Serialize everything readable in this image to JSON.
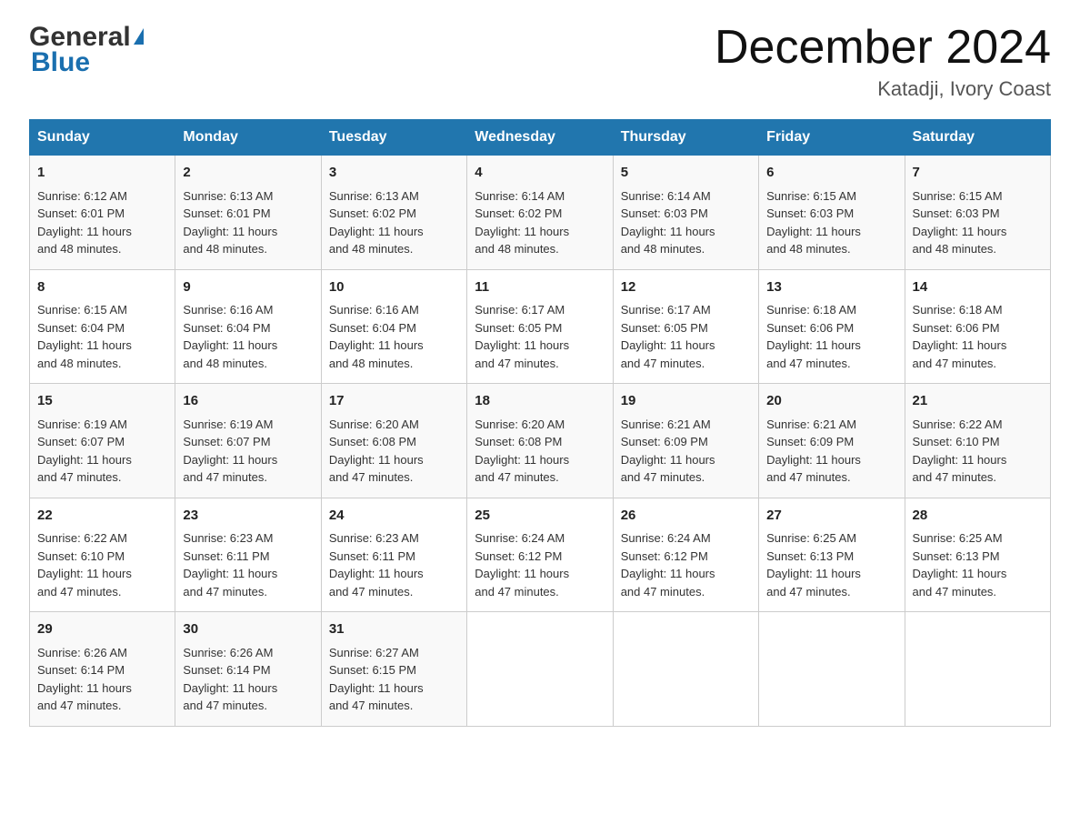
{
  "logo": {
    "name_part1": "General",
    "name_part2": "Blue"
  },
  "header": {
    "title": "December 2024",
    "location": "Katadji, Ivory Coast"
  },
  "columns": [
    "Sunday",
    "Monday",
    "Tuesday",
    "Wednesday",
    "Thursday",
    "Friday",
    "Saturday"
  ],
  "weeks": [
    [
      {
        "day": "1",
        "sunrise": "6:12 AM",
        "sunset": "6:01 PM",
        "daylight": "11 hours and 48 minutes."
      },
      {
        "day": "2",
        "sunrise": "6:13 AM",
        "sunset": "6:01 PM",
        "daylight": "11 hours and 48 minutes."
      },
      {
        "day": "3",
        "sunrise": "6:13 AM",
        "sunset": "6:02 PM",
        "daylight": "11 hours and 48 minutes."
      },
      {
        "day": "4",
        "sunrise": "6:14 AM",
        "sunset": "6:02 PM",
        "daylight": "11 hours and 48 minutes."
      },
      {
        "day": "5",
        "sunrise": "6:14 AM",
        "sunset": "6:03 PM",
        "daylight": "11 hours and 48 minutes."
      },
      {
        "day": "6",
        "sunrise": "6:15 AM",
        "sunset": "6:03 PM",
        "daylight": "11 hours and 48 minutes."
      },
      {
        "day": "7",
        "sunrise": "6:15 AM",
        "sunset": "6:03 PM",
        "daylight": "11 hours and 48 minutes."
      }
    ],
    [
      {
        "day": "8",
        "sunrise": "6:15 AM",
        "sunset": "6:04 PM",
        "daylight": "11 hours and 48 minutes."
      },
      {
        "day": "9",
        "sunrise": "6:16 AM",
        "sunset": "6:04 PM",
        "daylight": "11 hours and 48 minutes."
      },
      {
        "day": "10",
        "sunrise": "6:16 AM",
        "sunset": "6:04 PM",
        "daylight": "11 hours and 48 minutes."
      },
      {
        "day": "11",
        "sunrise": "6:17 AM",
        "sunset": "6:05 PM",
        "daylight": "11 hours and 47 minutes."
      },
      {
        "day": "12",
        "sunrise": "6:17 AM",
        "sunset": "6:05 PM",
        "daylight": "11 hours and 47 minutes."
      },
      {
        "day": "13",
        "sunrise": "6:18 AM",
        "sunset": "6:06 PM",
        "daylight": "11 hours and 47 minutes."
      },
      {
        "day": "14",
        "sunrise": "6:18 AM",
        "sunset": "6:06 PM",
        "daylight": "11 hours and 47 minutes."
      }
    ],
    [
      {
        "day": "15",
        "sunrise": "6:19 AM",
        "sunset": "6:07 PM",
        "daylight": "11 hours and 47 minutes."
      },
      {
        "day": "16",
        "sunrise": "6:19 AM",
        "sunset": "6:07 PM",
        "daylight": "11 hours and 47 minutes."
      },
      {
        "day": "17",
        "sunrise": "6:20 AM",
        "sunset": "6:08 PM",
        "daylight": "11 hours and 47 minutes."
      },
      {
        "day": "18",
        "sunrise": "6:20 AM",
        "sunset": "6:08 PM",
        "daylight": "11 hours and 47 minutes."
      },
      {
        "day": "19",
        "sunrise": "6:21 AM",
        "sunset": "6:09 PM",
        "daylight": "11 hours and 47 minutes."
      },
      {
        "day": "20",
        "sunrise": "6:21 AM",
        "sunset": "6:09 PM",
        "daylight": "11 hours and 47 minutes."
      },
      {
        "day": "21",
        "sunrise": "6:22 AM",
        "sunset": "6:10 PM",
        "daylight": "11 hours and 47 minutes."
      }
    ],
    [
      {
        "day": "22",
        "sunrise": "6:22 AM",
        "sunset": "6:10 PM",
        "daylight": "11 hours and 47 minutes."
      },
      {
        "day": "23",
        "sunrise": "6:23 AM",
        "sunset": "6:11 PM",
        "daylight": "11 hours and 47 minutes."
      },
      {
        "day": "24",
        "sunrise": "6:23 AM",
        "sunset": "6:11 PM",
        "daylight": "11 hours and 47 minutes."
      },
      {
        "day": "25",
        "sunrise": "6:24 AM",
        "sunset": "6:12 PM",
        "daylight": "11 hours and 47 minutes."
      },
      {
        "day": "26",
        "sunrise": "6:24 AM",
        "sunset": "6:12 PM",
        "daylight": "11 hours and 47 minutes."
      },
      {
        "day": "27",
        "sunrise": "6:25 AM",
        "sunset": "6:13 PM",
        "daylight": "11 hours and 47 minutes."
      },
      {
        "day": "28",
        "sunrise": "6:25 AM",
        "sunset": "6:13 PM",
        "daylight": "11 hours and 47 minutes."
      }
    ],
    [
      {
        "day": "29",
        "sunrise": "6:26 AM",
        "sunset": "6:14 PM",
        "daylight": "11 hours and 47 minutes."
      },
      {
        "day": "30",
        "sunrise": "6:26 AM",
        "sunset": "6:14 PM",
        "daylight": "11 hours and 47 minutes."
      },
      {
        "day": "31",
        "sunrise": "6:27 AM",
        "sunset": "6:15 PM",
        "daylight": "11 hours and 47 minutes."
      },
      null,
      null,
      null,
      null
    ]
  ],
  "labels": {
    "sunrise_prefix": "Sunrise: ",
    "sunset_prefix": "Sunset: ",
    "daylight_prefix": "Daylight: "
  }
}
